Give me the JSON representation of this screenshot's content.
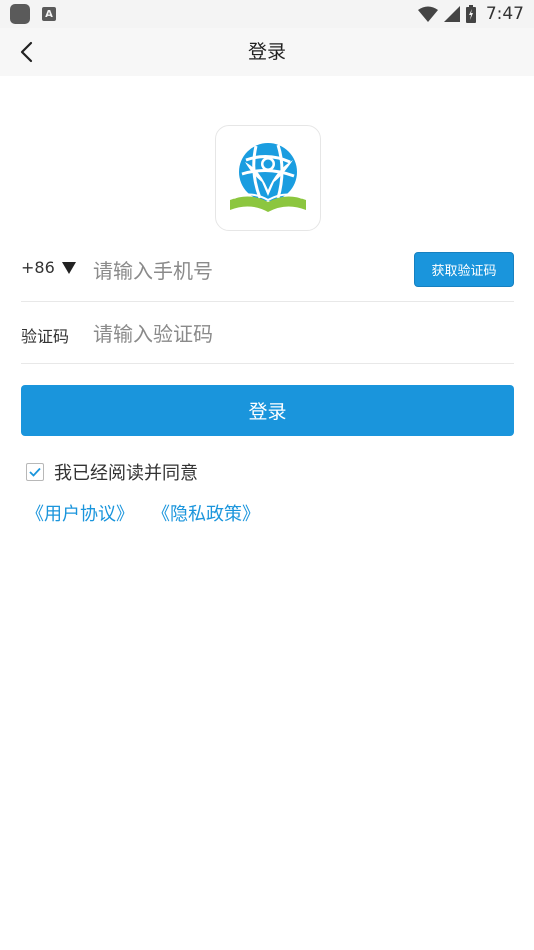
{
  "status_bar": {
    "time": "7:47",
    "a_icon_label": "A"
  },
  "nav": {
    "title": "登录"
  },
  "phone": {
    "country_code": "+86",
    "placeholder": "请输入手机号",
    "get_code_label": "获取验证码"
  },
  "verify": {
    "label": "验证码",
    "placeholder": "请输入验证码"
  },
  "login_button": "登录",
  "agreement": {
    "checked": true,
    "text": "我已经阅读并同意",
    "user_agreement": "《用户协议》",
    "privacy_policy": "《隐私政策》"
  },
  "colors": {
    "accent": "#1a95dc",
    "logo_green": "#8cc63f",
    "logo_blue": "#1a9de0"
  }
}
